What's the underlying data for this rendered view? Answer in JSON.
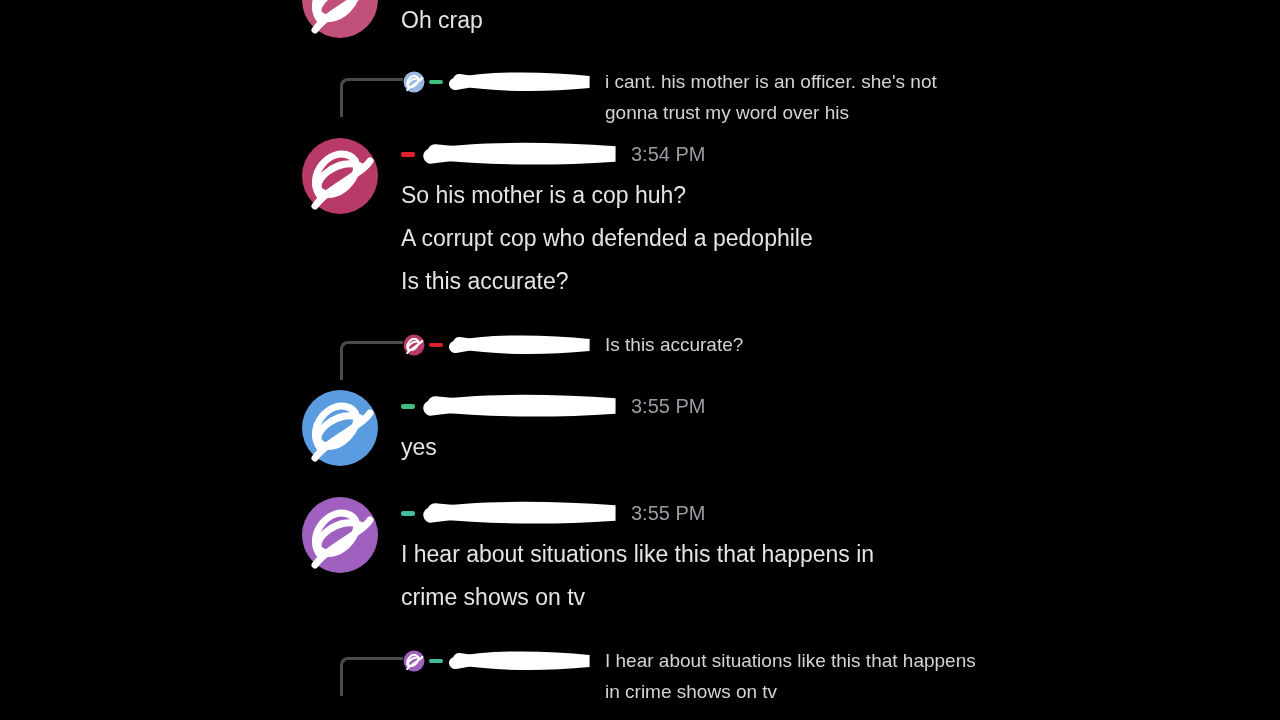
{
  "messages": [
    {
      "avatar": {
        "color": "#c0507a"
      },
      "lines": [
        "Oh crap"
      ]
    },
    {
      "reply": {
        "author": {
          "color": "#3fbf7f"
        },
        "avatar": {
          "color": "#9bb8e0"
        },
        "text": "i cant. his mother is an officer.  she's not gonna trust my word over his"
      },
      "author": {
        "color": "#e0202c"
      },
      "avatar": {
        "color": "#b83a68"
      },
      "time": "3:54 PM",
      "lines": [
        "So his mother is a cop huh?",
        "A corrupt cop who defended a pedophile",
        "Is this accurate?"
      ]
    },
    {
      "reply": {
        "author": {
          "color": "#e0202c"
        },
        "avatar": {
          "color": "#b83a68"
        },
        "text": "Is this accurate?"
      },
      "author": {
        "color": "#3fbf7f"
      },
      "avatar": {
        "color": "#5b9be0"
      },
      "time": "3:55 PM",
      "lines": [
        "yes"
      ]
    },
    {
      "author": {
        "color": "#3fbf9f"
      },
      "avatar": {
        "color": "#a060c0"
      },
      "time": "3:55 PM",
      "lines": [
        "I hear about situations like this that happens in crime shows on tv"
      ]
    },
    {
      "reply": {
        "author": {
          "color": "#3fbf9f"
        },
        "avatar": {
          "color": "#a060c0"
        },
        "text": "I hear about situations like this that happens in crime shows on tv"
      }
    }
  ]
}
